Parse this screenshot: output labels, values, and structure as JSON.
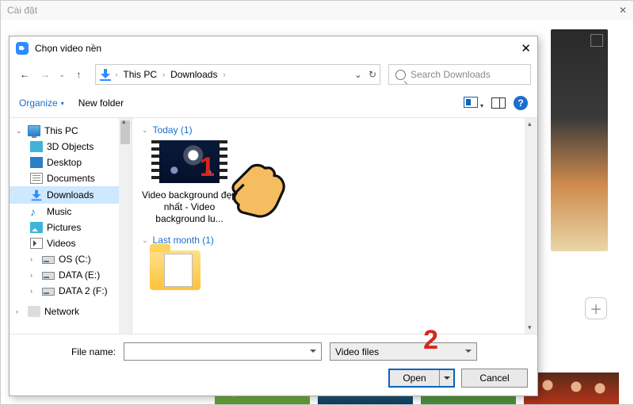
{
  "parent_window": {
    "title": "Cài đặt",
    "close": "✕",
    "plus": "＋"
  },
  "dialog": {
    "title": "Chọn video nền",
    "nav": {
      "breadcrumb_root": "This PC",
      "breadcrumb_current": "Downloads"
    },
    "search": {
      "placeholder": "Search Downloads"
    },
    "toolbar": {
      "organize": "Organize",
      "new_folder": "New folder",
      "view_dropdown": "▾",
      "help": "?"
    },
    "tree": {
      "items": [
        {
          "label": "This PC"
        },
        {
          "label": "3D Objects"
        },
        {
          "label": "Desktop"
        },
        {
          "label": "Documents"
        },
        {
          "label": "Downloads"
        },
        {
          "label": "Music"
        },
        {
          "label": "Pictures"
        },
        {
          "label": "Videos"
        },
        {
          "label": "OS (C:)"
        },
        {
          "label": "DATA (E:)"
        },
        {
          "label": "DATA 2 (F:)"
        },
        {
          "label": "Network"
        }
      ]
    },
    "content": {
      "groups": [
        {
          "header": "Today (1)",
          "files": [
            {
              "name": "Video background đẹp nhất - Video background lu..."
            }
          ]
        },
        {
          "header": "Last month (1)"
        }
      ]
    },
    "footer": {
      "file_name_label": "File name:",
      "file_name_value": "",
      "filter_selected": "Video files",
      "open_label": "Open",
      "cancel_label": "Cancel"
    }
  },
  "annotations": {
    "marker1": "1",
    "marker2": "2"
  }
}
